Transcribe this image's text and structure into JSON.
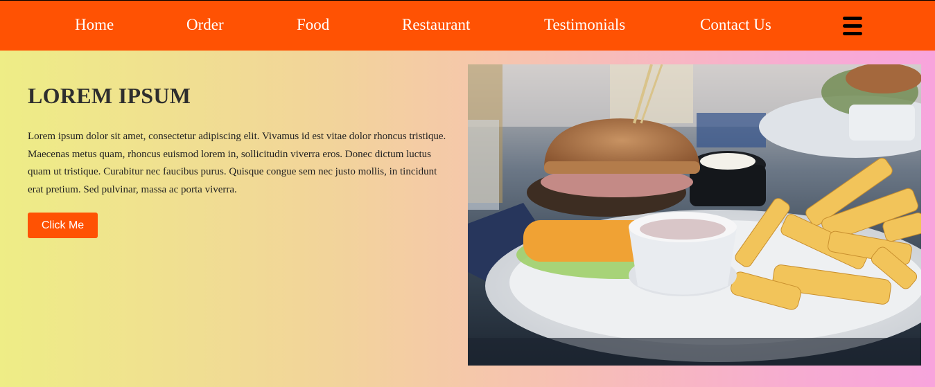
{
  "nav": {
    "items": [
      {
        "label": "Home"
      },
      {
        "label": "Order"
      },
      {
        "label": "Food"
      },
      {
        "label": "Restaurant"
      },
      {
        "label": "Testimonials"
      },
      {
        "label": "Contact Us"
      }
    ],
    "menu_icon": "hamburger-menu-icon",
    "background_color": "#ff5203",
    "text_color": "#ffffff"
  },
  "hero": {
    "title": "LOREM IPSUM",
    "body": "Lorem ipsum dolor sit amet, consectetur adipiscing elit. Vivamus id est vitae dolor rhoncus tristique. Maecenas metus quam, rhoncus euismod lorem in, sollicitudin viverra eros. Donec dictum luctus quam ut tristique. Curabitur nec faucibus purus. Quisque congue sem nec justo mollis, in tincidunt erat pretium. Sed pulvinar, massa ac porta viverra.",
    "button_label": "Click Me",
    "button_color": "#ff5203",
    "image": "burger-and-fries-photo"
  },
  "page": {
    "gradient_start": "#eeed86",
    "gradient_end": "#f8a4dc"
  }
}
